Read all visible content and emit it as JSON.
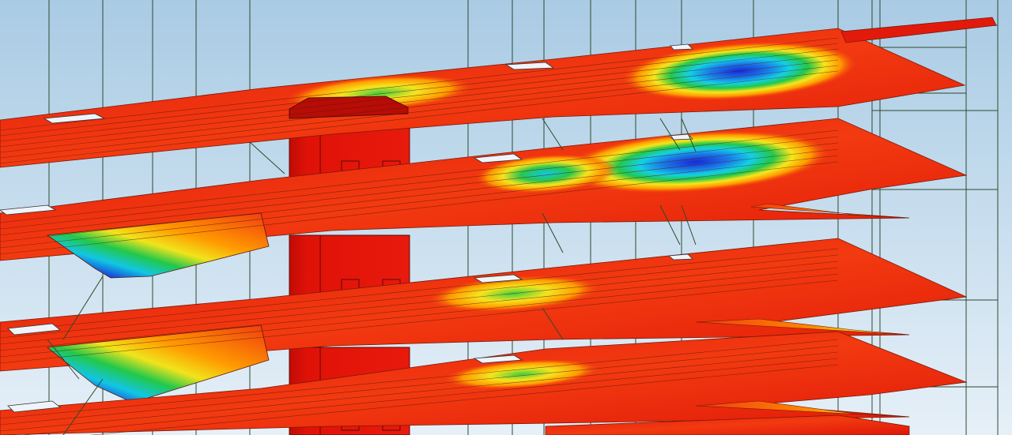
{
  "viewport": {
    "background_top": "#a9cbe4",
    "background_bottom": "#e6f0f8"
  },
  "model": {
    "type": "structural-fea-slab-deformation",
    "colors": {
      "slab_high": "#e82010",
      "slab_mid": "#ff9a00",
      "slab_yellow": "#f7e81a",
      "slab_green": "#20c848",
      "slab_cyan": "#10d0e8",
      "slab_blue": "#1030e0",
      "slab_purple": "#7a20c0",
      "core_wall": "#e01208",
      "core_wall_dark": "#b80c06",
      "frame_line": "#2d4a2d",
      "mesh_line": "#5a1a0a"
    },
    "floors_visible": 5,
    "contour_scale": "red-orange-yellow-green-cyan-blue-purple"
  }
}
